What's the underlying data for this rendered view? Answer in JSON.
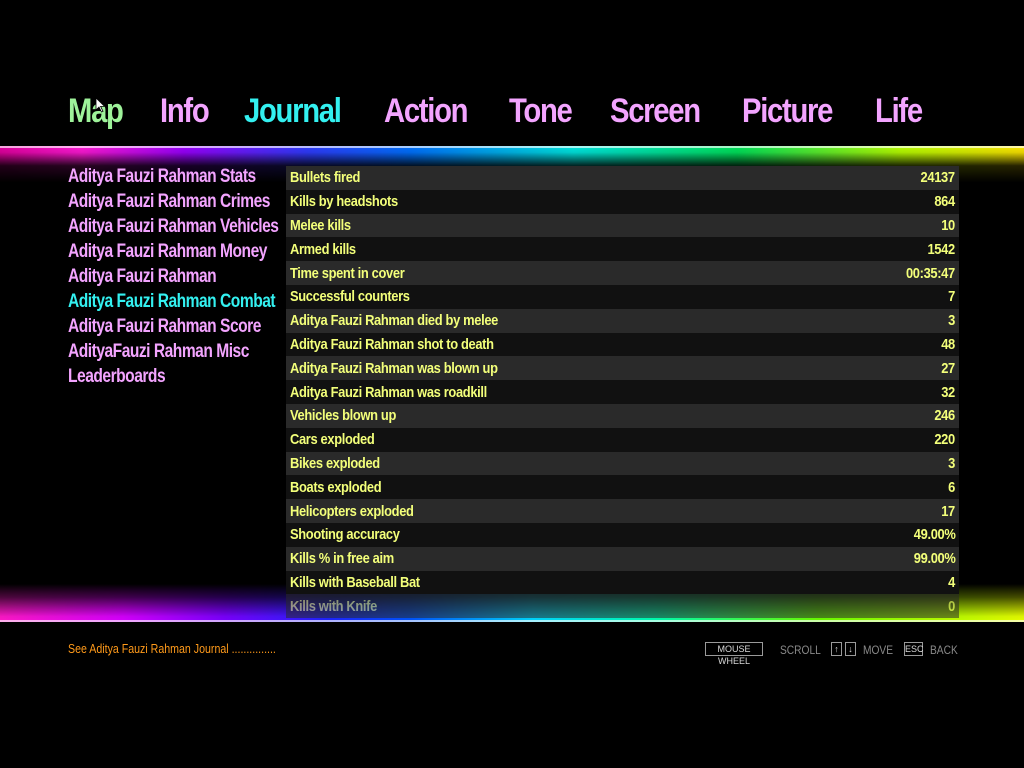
{
  "tabs": [
    {
      "label": "Map",
      "color": "#9ef29a"
    },
    {
      "label": "Info",
      "color": "#f3a4ff"
    },
    {
      "label": "Journal",
      "color": "#33f0f0"
    },
    {
      "label": "Action",
      "color": "#f3a4ff"
    },
    {
      "label": "Tone",
      "color": "#f3a4ff"
    },
    {
      "label": "Screen",
      "color": "#f3a4ff"
    },
    {
      "label": "Picture",
      "color": "#f3a4ff"
    },
    {
      "label": "Life",
      "color": "#f3a4ff"
    }
  ],
  "active_tab": "Journal",
  "menu": [
    {
      "label": "Aditya Fauzi Rahman Stats",
      "color": "#f3a4ff"
    },
    {
      "label": "Aditya Fauzi Rahman Crimes",
      "color": "#f3a4ff"
    },
    {
      "label": "Aditya Fauzi Rahman Vehicles",
      "color": "#f3a4ff"
    },
    {
      "label": "Aditya Fauzi Rahman Money",
      "color": "#f3a4ff"
    },
    {
      "label": "Aditya Fauzi Rahman",
      "color": "#f3a4ff"
    },
    {
      "label": "Aditya Fauzi Rahman Combat",
      "color": "#33f0f0"
    },
    {
      "label": "Aditya Fauzi Rahman Score",
      "color": "#f3a4ff"
    },
    {
      "label": "AdityaFauzi Rahman Misc",
      "color": "#f3a4ff"
    },
    {
      "label": "Leaderboards",
      "color": "#f3a4ff"
    }
  ],
  "active_menu": "Aditya Fauzi Rahman Combat",
  "stats": [
    {
      "label": "Bullets fired",
      "value": "24137"
    },
    {
      "label": "Kills by headshots",
      "value": "864"
    },
    {
      "label": "Melee kills",
      "value": "10"
    },
    {
      "label": "Armed kills",
      "value": "1542"
    },
    {
      "label": "Time spent in cover",
      "value": "00:35:47"
    },
    {
      "label": "Successful counters",
      "value": "7"
    },
    {
      "label": "Aditya Fauzi Rahman died by melee",
      "value": "3"
    },
    {
      "label": "Aditya Fauzi Rahman shot to death",
      "value": "48"
    },
    {
      "label": "Aditya Fauzi Rahman was blown up",
      "value": "27"
    },
    {
      "label": "Aditya Fauzi Rahman was roadkill",
      "value": "32"
    },
    {
      "label": "Vehicles blown up",
      "value": "246"
    },
    {
      "label": "Cars exploded",
      "value": "220"
    },
    {
      "label": "Bikes exploded",
      "value": "3"
    },
    {
      "label": "Boats exploded",
      "value": "6"
    },
    {
      "label": "Helicopters exploded",
      "value": "17"
    },
    {
      "label": "Shooting accuracy",
      "value": "49.00%"
    },
    {
      "label": "Kills % in free aim",
      "value": "99.00%"
    },
    {
      "label": "Kills with Baseball Bat",
      "value": "4"
    },
    {
      "label": "Kills with Knife",
      "value": "0"
    }
  ],
  "footer": {
    "link": "See Aditya Fauzi Rahman Journal ...............",
    "link_color": "#ff9a1a"
  },
  "controls": {
    "mouse_wheel_key": "MOUSE WHEEL",
    "scroll_label": "SCROLL",
    "up_key": "↑",
    "down_key": "↓",
    "move_label": "MOVE",
    "esc_key": "ESC",
    "back_label": "BACK"
  },
  "colors": {
    "stat_text": "#f3ff7a",
    "row_dark": "#111111",
    "row_light": "#2a2a2a",
    "inactive": "#f3a4ff",
    "active": "#33f0f0",
    "map_tab": "#9ef29a"
  }
}
